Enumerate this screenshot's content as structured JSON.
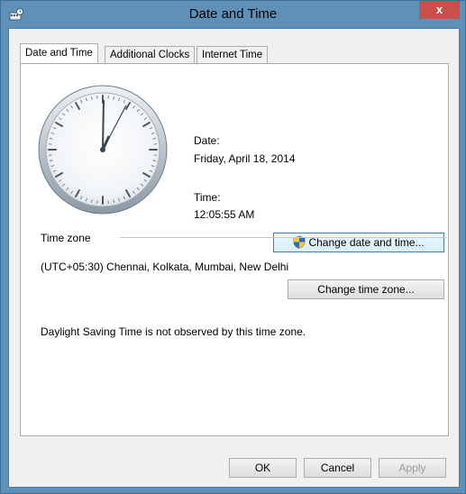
{
  "window": {
    "title": "Date and Time",
    "close_label": "x"
  },
  "tabs": [
    {
      "label": "Date and Time",
      "active": true
    },
    {
      "label": "Additional Clocks",
      "active": false
    },
    {
      "label": "Internet Time",
      "active": false
    }
  ],
  "datetime": {
    "date_label": "Date:",
    "date_value": "Friday, April 18, 2014",
    "time_label": "Time:",
    "time_value": "12:05:55 AM",
    "change_button": "Change date and time..."
  },
  "timezone": {
    "group_label": "Time zone",
    "value": "(UTC+05:30) Chennai, Kolkata, Mumbai, New Delhi",
    "change_button": "Change time zone...",
    "dst_message": "Daylight Saving Time is not observed by this time zone."
  },
  "footer": {
    "ok": "OK",
    "cancel": "Cancel",
    "apply": "Apply"
  },
  "colors": {
    "titlebar": "#5f91b8",
    "close": "#c7504b",
    "focus_border": "#3c7fb1"
  }
}
